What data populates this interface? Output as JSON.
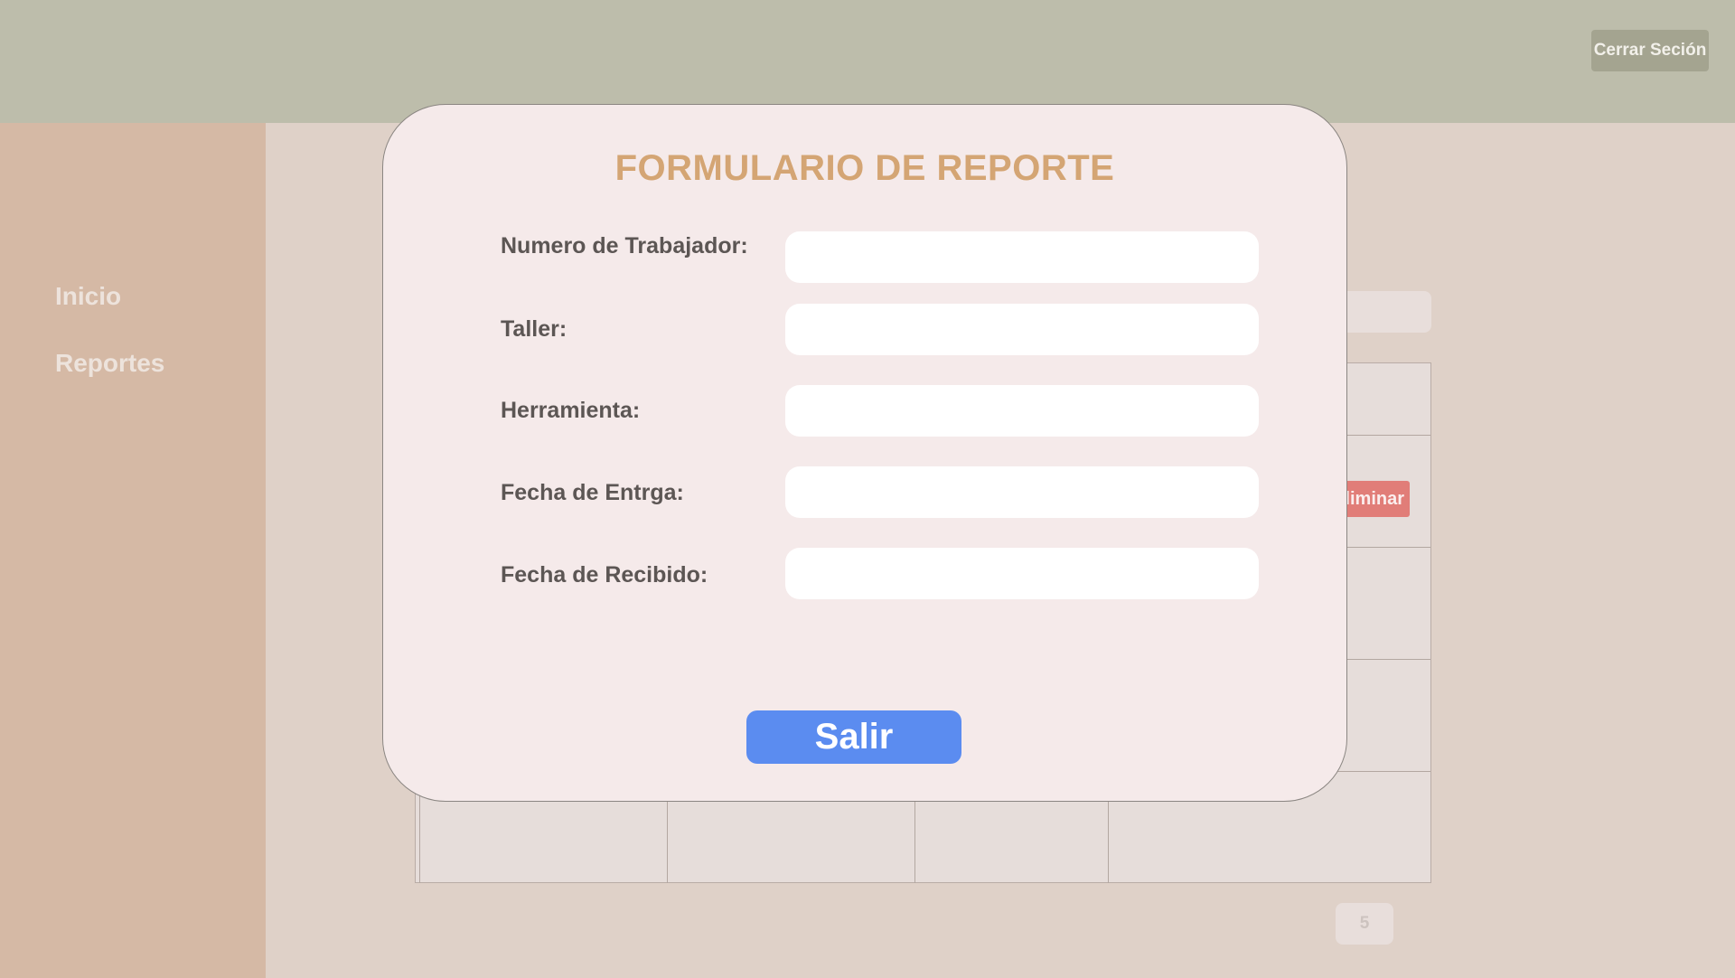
{
  "header": {
    "logout_label": "Cerrar Seción"
  },
  "sidebar": {
    "items": [
      {
        "label": "Inicio"
      },
      {
        "label": "Reportes"
      }
    ]
  },
  "table": {
    "delete_label": "Eliminar"
  },
  "pagination": {
    "page": "5"
  },
  "modal": {
    "title": "FORMULARIO DE REPORTE",
    "fields": [
      {
        "label": "Numero de Trabajador:",
        "value": ""
      },
      {
        "label": "Taller:",
        "value": ""
      },
      {
        "label": "Herramienta:",
        "value": ""
      },
      {
        "label": "Fecha de Entrga:",
        "value": ""
      },
      {
        "label": "Fecha de Recibido:",
        "value": ""
      }
    ],
    "exit_label": "Salir"
  },
  "colors": {
    "header": "#bdbdab",
    "sidebar": "#d5b9a5",
    "accent_title": "#d4a574",
    "primary_button": "#5b8cf0",
    "danger_button": "#e17d78"
  }
}
